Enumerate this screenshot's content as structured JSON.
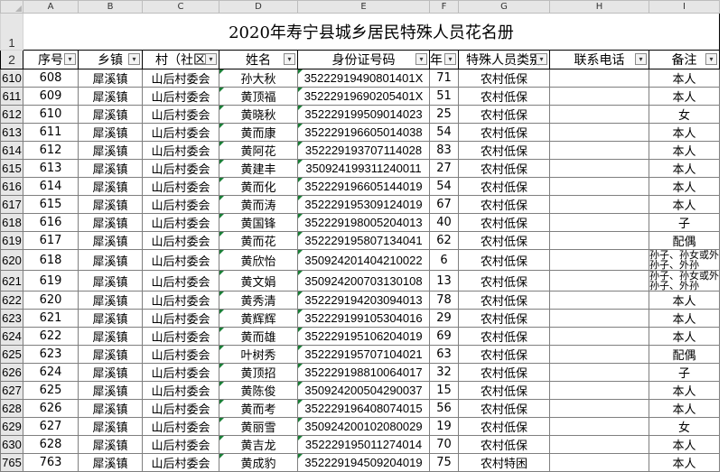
{
  "column_headers": [
    "A",
    "B",
    "C",
    "D",
    "E",
    "F",
    "G",
    "H",
    "I"
  ],
  "title_row_number": "1",
  "header_row_number": "2",
  "title": "2020年寿宁县城乡居民特殊人员花名册",
  "headers": {
    "seq": "序号",
    "town": "乡镇",
    "village": "村（社区",
    "name": "姓名",
    "id": "身份证号码",
    "age": "年",
    "kind": "特殊人员类别",
    "phone": "联系电话",
    "note": "备注"
  },
  "dropdown_glyph": "▾",
  "rows": [
    {
      "r": "610",
      "seq": "608",
      "town": "犀溪镇",
      "village": "山后村委会",
      "name": "孙大秋",
      "id": "35222919490801401X",
      "age": "71",
      "kind": "农村低保",
      "phone": "",
      "note": "本人"
    },
    {
      "r": "611",
      "seq": "609",
      "town": "犀溪镇",
      "village": "山后村委会",
      "name": "黄顶福",
      "id": "35222919690205401X",
      "age": "51",
      "kind": "农村低保",
      "phone": "",
      "note": "本人"
    },
    {
      "r": "612",
      "seq": "610",
      "town": "犀溪镇",
      "village": "山后村委会",
      "name": "黄晓秋",
      "id": "352229199509014023",
      "age": "25",
      "kind": "农村低保",
      "phone": "",
      "note": "女"
    },
    {
      "r": "613",
      "seq": "611",
      "town": "犀溪镇",
      "village": "山后村委会",
      "name": "黄而康",
      "id": "352229196605014038",
      "age": "54",
      "kind": "农村低保",
      "phone": "",
      "note": "本人"
    },
    {
      "r": "614",
      "seq": "612",
      "town": "犀溪镇",
      "village": "山后村委会",
      "name": "黄阿花",
      "id": "352229193707114028",
      "age": "83",
      "kind": "农村低保",
      "phone": "",
      "note": "本人"
    },
    {
      "r": "615",
      "seq": "613",
      "town": "犀溪镇",
      "village": "山后村委会",
      "name": "黄建丰",
      "id": "350924199311240011",
      "age": "27",
      "kind": "农村低保",
      "phone": "",
      "note": "本人"
    },
    {
      "r": "616",
      "seq": "614",
      "town": "犀溪镇",
      "village": "山后村委会",
      "name": "黄而化",
      "id": "352229196605144019",
      "age": "54",
      "kind": "农村低保",
      "phone": "",
      "note": "本人"
    },
    {
      "r": "617",
      "seq": "615",
      "town": "犀溪镇",
      "village": "山后村委会",
      "name": "黄而涛",
      "id": "352229195309124019",
      "age": "67",
      "kind": "农村低保",
      "phone": "",
      "note": "本人"
    },
    {
      "r": "618",
      "seq": "616",
      "town": "犀溪镇",
      "village": "山后村委会",
      "name": "黄国锋",
      "id": "352229198005204013",
      "age": "40",
      "kind": "农村低保",
      "phone": "",
      "note": "子"
    },
    {
      "r": "619",
      "seq": "617",
      "town": "犀溪镇",
      "village": "山后村委会",
      "name": "黄而花",
      "id": "352229195807134041",
      "age": "62",
      "kind": "农村低保",
      "phone": "",
      "note": "配偶"
    },
    {
      "r": "620",
      "seq": "618",
      "town": "犀溪镇",
      "village": "山后村委会",
      "name": "黄欣怡",
      "id": "350924201404210022",
      "age": "6",
      "kind": "农村低保",
      "phone": "",
      "note": "孙子、孙女或外孙子、外孙"
    },
    {
      "r": "621",
      "seq": "619",
      "town": "犀溪镇",
      "village": "山后村委会",
      "name": "黄文娟",
      "id": "350924200703130108",
      "age": "13",
      "kind": "农村低保",
      "phone": "",
      "note": "孙子、孙女或外孙子、外孙"
    },
    {
      "r": "622",
      "seq": "620",
      "town": "犀溪镇",
      "village": "山后村委会",
      "name": "黄秀清",
      "id": "352229194203094013",
      "age": "78",
      "kind": "农村低保",
      "phone": "",
      "note": "本人"
    },
    {
      "r": "623",
      "seq": "621",
      "town": "犀溪镇",
      "village": "山后村委会",
      "name": "黄辉辉",
      "id": "352229199105304016",
      "age": "29",
      "kind": "农村低保",
      "phone": "",
      "note": "本人"
    },
    {
      "r": "624",
      "seq": "622",
      "town": "犀溪镇",
      "village": "山后村委会",
      "name": "黄而雄",
      "id": "352229195106204019",
      "age": "69",
      "kind": "农村低保",
      "phone": "",
      "note": "本人"
    },
    {
      "r": "625",
      "seq": "623",
      "town": "犀溪镇",
      "village": "山后村委会",
      "name": "叶树秀",
      "id": "352229195707104021",
      "age": "63",
      "kind": "农村低保",
      "phone": "",
      "note": "配偶"
    },
    {
      "r": "626",
      "seq": "624",
      "town": "犀溪镇",
      "village": "山后村委会",
      "name": "黄顶招",
      "id": "352229198810064017",
      "age": "32",
      "kind": "农村低保",
      "phone": "",
      "note": "子"
    },
    {
      "r": "627",
      "seq": "625",
      "town": "犀溪镇",
      "village": "山后村委会",
      "name": "黄陈俊",
      "id": "350924200504290037",
      "age": "15",
      "kind": "农村低保",
      "phone": "",
      "note": "本人"
    },
    {
      "r": "628",
      "seq": "626",
      "town": "犀溪镇",
      "village": "山后村委会",
      "name": "黄而考",
      "id": "352229196408074015",
      "age": "56",
      "kind": "农村低保",
      "phone": "",
      "note": "本人"
    },
    {
      "r": "629",
      "seq": "627",
      "town": "犀溪镇",
      "village": "山后村委会",
      "name": "黄丽雪",
      "id": "350924200102080029",
      "age": "19",
      "kind": "农村低保",
      "phone": "",
      "note": "女"
    },
    {
      "r": "630",
      "seq": "628",
      "town": "犀溪镇",
      "village": "山后村委会",
      "name": "黄吉龙",
      "id": "352229195011274014",
      "age": "70",
      "kind": "农村低保",
      "phone": "",
      "note": "本人"
    },
    {
      "r": "765",
      "seq": "763",
      "town": "犀溪镇",
      "village": "山后村委会",
      "name": "黄成豹",
      "id": "352229194509204019",
      "age": "75",
      "kind": "农村特困",
      "phone": "",
      "note": "本人"
    }
  ]
}
